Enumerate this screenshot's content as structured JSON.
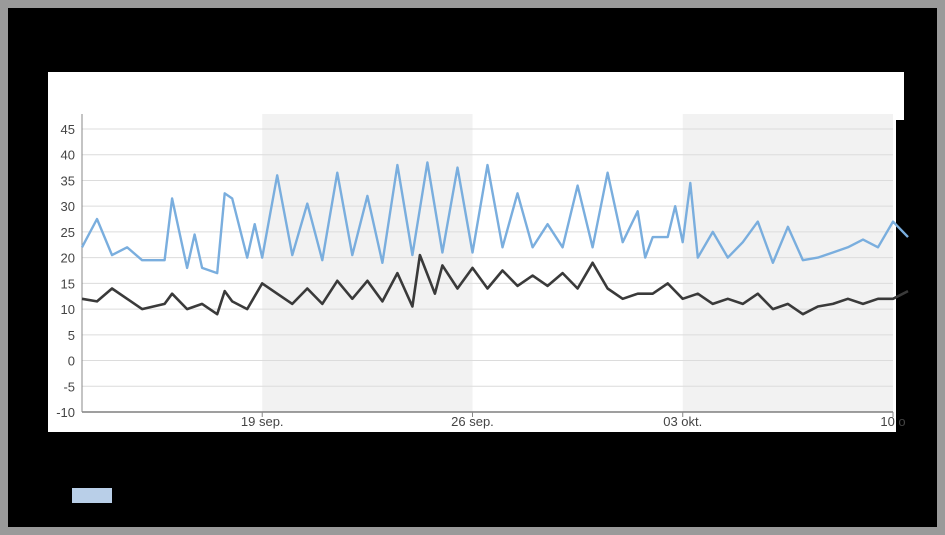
{
  "chart_data": {
    "type": "line",
    "x_range": [
      "2021-09-13",
      "2021-10-10"
    ],
    "ylim": [
      -10,
      45
    ],
    "y_ticks": [
      "45",
      "40",
      "35",
      "30",
      "25",
      "20",
      "15",
      "10",
      "5",
      "0",
      "-5",
      "-10"
    ],
    "x_ticks": [
      {
        "date": "2021-09-19",
        "label": "19 sep."
      },
      {
        "date": "2021-09-26",
        "label": "26 sep."
      },
      {
        "date": "2021-10-03",
        "label": "03 okt."
      },
      {
        "date": "2021-10-10",
        "label": "10 o"
      }
    ],
    "grid": true,
    "week_bands": [
      [
        "2021-09-19",
        "2021-09-26"
      ],
      [
        "2021-10-03",
        "2021-10-10"
      ]
    ],
    "colors": {
      "series_blue": "#7aaede",
      "series_dark": "#3a3a3a",
      "band": "#f2f2f2",
      "grid": "#dcdcdc"
    },
    "series": [
      {
        "color": "#7aaede",
        "points": [
          [
            "2021-09-13",
            22
          ],
          [
            "2021-09-13T12:00",
            27.5
          ],
          [
            "2021-09-14",
            20.5
          ],
          [
            "2021-09-14T12:00",
            22
          ],
          [
            "2021-09-15",
            19.5
          ],
          [
            "2021-09-15T18:00",
            19.5
          ],
          [
            "2021-09-16",
            31.5
          ],
          [
            "2021-09-16T12:00",
            18
          ],
          [
            "2021-09-16T18:00",
            24.5
          ],
          [
            "2021-09-17",
            18
          ],
          [
            "2021-09-17T12:00",
            17
          ],
          [
            "2021-09-17T18:00",
            32.5
          ],
          [
            "2021-09-18",
            31.5
          ],
          [
            "2021-09-18T12:00",
            20
          ],
          [
            "2021-09-18T18:00",
            26.5
          ],
          [
            "2021-09-19",
            20
          ],
          [
            "2021-09-19T12:00",
            36
          ],
          [
            "2021-09-20",
            20.5
          ],
          [
            "2021-09-20T12:00",
            30.5
          ],
          [
            "2021-09-21",
            19.5
          ],
          [
            "2021-09-21T12:00",
            36.5
          ],
          [
            "2021-09-22",
            20.5
          ],
          [
            "2021-09-22T12:00",
            32
          ],
          [
            "2021-09-23",
            19
          ],
          [
            "2021-09-23T12:00",
            38
          ],
          [
            "2021-09-24",
            20.5
          ],
          [
            "2021-09-24T12:00",
            38.5
          ],
          [
            "2021-09-25",
            21
          ],
          [
            "2021-09-25T12:00",
            37.5
          ],
          [
            "2021-09-26",
            21
          ],
          [
            "2021-09-26T12:00",
            38
          ],
          [
            "2021-09-27",
            22
          ],
          [
            "2021-09-27T12:00",
            32.5
          ],
          [
            "2021-09-28",
            22
          ],
          [
            "2021-09-28T12:00",
            26.5
          ],
          [
            "2021-09-29",
            22
          ],
          [
            "2021-09-29T12:00",
            34
          ],
          [
            "2021-09-30",
            22
          ],
          [
            "2021-09-30T12:00",
            36.5
          ],
          [
            "2021-10-01",
            23
          ],
          [
            "2021-10-01T12:00",
            29
          ],
          [
            "2021-10-01T18:00",
            20
          ],
          [
            "2021-10-02",
            24
          ],
          [
            "2021-10-02T12:00",
            24
          ],
          [
            "2021-10-02T18:00",
            30
          ],
          [
            "2021-10-03",
            23
          ],
          [
            "2021-10-03T06:00",
            34.5
          ],
          [
            "2021-10-03T12:00",
            20
          ],
          [
            "2021-10-04",
            25
          ],
          [
            "2021-10-04T12:00",
            20
          ],
          [
            "2021-10-05",
            23
          ],
          [
            "2021-10-05T12:00",
            27
          ],
          [
            "2021-10-06",
            19
          ],
          [
            "2021-10-06T12:00",
            26
          ],
          [
            "2021-10-07",
            19.5
          ],
          [
            "2021-10-07T12:00",
            20
          ],
          [
            "2021-10-08",
            21
          ],
          [
            "2021-10-08T12:00",
            22
          ],
          [
            "2021-10-09",
            23.5
          ],
          [
            "2021-10-09T12:00",
            22
          ],
          [
            "2021-10-10",
            27
          ],
          [
            "2021-10-10T12:00",
            24
          ]
        ]
      },
      {
        "color": "#3a3a3a",
        "points": [
          [
            "2021-09-13",
            12
          ],
          [
            "2021-09-13T12:00",
            11.5
          ],
          [
            "2021-09-14",
            14
          ],
          [
            "2021-09-14T12:00",
            12
          ],
          [
            "2021-09-15",
            10
          ],
          [
            "2021-09-15T18:00",
            11
          ],
          [
            "2021-09-16",
            13
          ],
          [
            "2021-09-16T12:00",
            10
          ],
          [
            "2021-09-17",
            11
          ],
          [
            "2021-09-17T12:00",
            9
          ],
          [
            "2021-09-17T18:00",
            13.5
          ],
          [
            "2021-09-18",
            11.5
          ],
          [
            "2021-09-18T12:00",
            10
          ],
          [
            "2021-09-19",
            15
          ],
          [
            "2021-09-19T12:00",
            13
          ],
          [
            "2021-09-20",
            11
          ],
          [
            "2021-09-20T12:00",
            14
          ],
          [
            "2021-09-21",
            11
          ],
          [
            "2021-09-21T12:00",
            15.5
          ],
          [
            "2021-09-22",
            12
          ],
          [
            "2021-09-22T12:00",
            15.5
          ],
          [
            "2021-09-23",
            11.5
          ],
          [
            "2021-09-23T12:00",
            17
          ],
          [
            "2021-09-24",
            10.5
          ],
          [
            "2021-09-24T06:00",
            20.5
          ],
          [
            "2021-09-24T18:00",
            13
          ],
          [
            "2021-09-25",
            18.5
          ],
          [
            "2021-09-25T12:00",
            14
          ],
          [
            "2021-09-26",
            18
          ],
          [
            "2021-09-26T12:00",
            14
          ],
          [
            "2021-09-27",
            17.5
          ],
          [
            "2021-09-27T12:00",
            14.5
          ],
          [
            "2021-09-28",
            16.5
          ],
          [
            "2021-09-28T12:00",
            14.5
          ],
          [
            "2021-09-29",
            17
          ],
          [
            "2021-09-29T12:00",
            14
          ],
          [
            "2021-09-30",
            19
          ],
          [
            "2021-09-30T12:00",
            14
          ],
          [
            "2021-10-01",
            12
          ],
          [
            "2021-10-01T12:00",
            13
          ],
          [
            "2021-10-02",
            13
          ],
          [
            "2021-10-02T12:00",
            15
          ],
          [
            "2021-10-03",
            12
          ],
          [
            "2021-10-03T12:00",
            13
          ],
          [
            "2021-10-04",
            11
          ],
          [
            "2021-10-04T12:00",
            12
          ],
          [
            "2021-10-05",
            11
          ],
          [
            "2021-10-05T12:00",
            13
          ],
          [
            "2021-10-06",
            10
          ],
          [
            "2021-10-06T12:00",
            11
          ],
          [
            "2021-10-07",
            9
          ],
          [
            "2021-10-07T12:00",
            10.5
          ],
          [
            "2021-10-08",
            11
          ],
          [
            "2021-10-08T12:00",
            12
          ],
          [
            "2021-10-09",
            11
          ],
          [
            "2021-10-09T12:00",
            12
          ],
          [
            "2021-10-10",
            12
          ],
          [
            "2021-10-10T12:00",
            13.5
          ]
        ]
      }
    ]
  }
}
